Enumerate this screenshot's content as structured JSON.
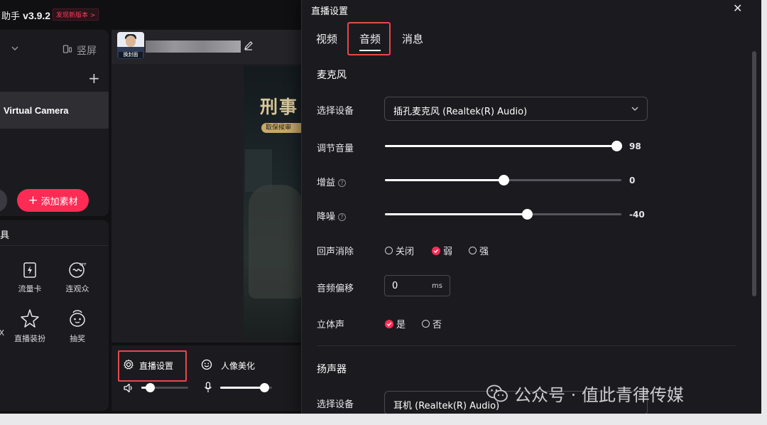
{
  "app": {
    "title_prefix": "助手",
    "version": "v3.9.2",
    "new_version_badge": "发现新版本 >"
  },
  "left_panel": {
    "portrait_label": "竖屏",
    "source_item": "Virtual Camera",
    "add_button": "添加素材",
    "add_icon": "+",
    "tools_title": "具",
    "tools": [
      {
        "label": "流量卡",
        "icon": "lightning-card-icon"
      },
      {
        "label": "连观众",
        "icon": "link-audience-icon"
      },
      {
        "label": "直播装扮",
        "icon": "sparkle-star-icon"
      },
      {
        "label": "抽奖",
        "icon": "lottery-bag-icon"
      }
    ],
    "partial_tool_glyph": "X"
  },
  "preview": {
    "avatar_tag": "换封面",
    "video_title": "刑事",
    "video_subtitle": "取保候审"
  },
  "bottom_controls": {
    "live_settings_label": "直播设置",
    "beauty_label": "人像美化",
    "speaker_volume": 0.18,
    "mic_volume": 0.85
  },
  "dialog": {
    "title": "直播设置",
    "close_glyph": "✕",
    "tabs": [
      {
        "label": "视频",
        "active": false
      },
      {
        "label": "音频",
        "active": true
      },
      {
        "label": "消息",
        "active": false
      }
    ],
    "mic_section": "麦克风",
    "select_device_label": "选择设备",
    "mic_device": "插孔麦克风 (Realtek(R) Audio)",
    "volume": {
      "label": "调节音量",
      "value": 98,
      "min": 0,
      "max": 100,
      "display": "98"
    },
    "gain": {
      "label": "增益",
      "value": 0,
      "min": -50,
      "max": 50,
      "display": "0"
    },
    "denoise": {
      "label": "降噪",
      "value": -40,
      "min": -100,
      "max": 0,
      "display": "-40"
    },
    "echo": {
      "label": "回声消除",
      "options": [
        "关闭",
        "弱",
        "强"
      ],
      "selected": "弱"
    },
    "offset": {
      "label": "音频偏移",
      "value": "0",
      "unit": "ms"
    },
    "stereo": {
      "label": "立体声",
      "options": [
        "是",
        "否"
      ],
      "selected": "是"
    },
    "speaker_section": "扬声器",
    "speaker_select_label": "选择设备",
    "speaker_device": "耳机 (Realtek(R) Audio)",
    "help_glyph": "?"
  },
  "watermark": {
    "text": "公众号 · 值此青律传媒"
  },
  "colors": {
    "accent": "#fe2c55",
    "highlight_box": "#e5484d",
    "panel": "#1b1b1f",
    "background": "#111114"
  }
}
